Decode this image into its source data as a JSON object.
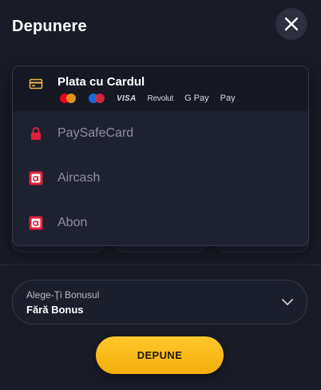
{
  "header": {
    "title": "Depunere",
    "close_icon": "close-icon"
  },
  "payment_methods": {
    "options": [
      {
        "label": "Plata cu Cardul",
        "icon": "credit-card-icon",
        "selected": true,
        "logos": [
          "mastercard-logo",
          "maestro-logo",
          "VISA",
          "Revolut",
          "G Pay",
          " Pay"
        ]
      },
      {
        "label": "PaySafeCard",
        "icon": "lock-icon"
      },
      {
        "label": "Aircash",
        "icon": "aircash-icon"
      },
      {
        "label": "Abon",
        "icon": "abon-icon"
      }
    ]
  },
  "bonus": {
    "label": "Alege-Ţi Bonusul",
    "value": "Fără Bonus",
    "icon": "chevron-down-icon"
  },
  "submit": {
    "label": "DEPUNE"
  },
  "colors": {
    "background": "#191b26",
    "accent": "#ffc82a",
    "brand_red": "#e41f3b",
    "card_gold": "#e6b54a"
  }
}
